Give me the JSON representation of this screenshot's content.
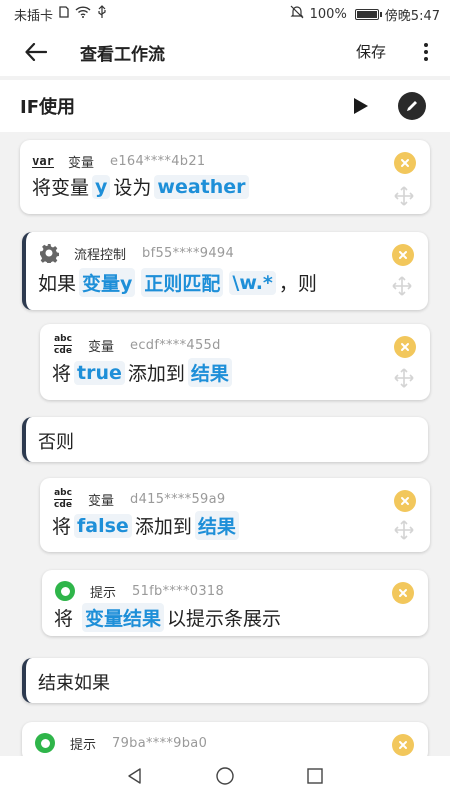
{
  "status_bar": {
    "carrier": "未插卡",
    "battery_text": "100%",
    "battery_level": 1.0,
    "time": "傍晚5:47"
  },
  "app_bar": {
    "title": "查看工作流",
    "save_label": "保存",
    "back_icon": "arrow-left-icon",
    "more_icon": "more-vert-icon"
  },
  "workflow": {
    "name": "IF使用",
    "run_icon": "play-icon",
    "edit_icon": "pencil-icon"
  },
  "cards": [
    {
      "icon_text": "var",
      "category": "变量",
      "id": "e164****4b21",
      "parts": [
        "将变量",
        "y",
        "设为",
        "weather"
      ]
    },
    {
      "category": "流程控制",
      "id": "bf55****9494",
      "parts": [
        "如果",
        "变量y",
        "正则匹配",
        "\\w.*",
        "，则"
      ]
    },
    {
      "icon_text_top": "abc",
      "icon_text_bottom": "cde",
      "category": "变量",
      "id": "ecdf****455d",
      "parts": [
        "将",
        "true",
        "添加到",
        "结果"
      ]
    },
    {
      "label": "否则"
    },
    {
      "icon_text_top": "abc",
      "icon_text_bottom": "cde",
      "category": "变量",
      "id": "d415****59a9",
      "parts": [
        "将",
        "false",
        "添加到",
        "结果"
      ]
    },
    {
      "category": "提示",
      "id": "51fb****0318",
      "parts": [
        "将",
        "变量结果",
        "以提示条展示"
      ]
    },
    {
      "label": "结束如果"
    },
    {
      "category": "提示",
      "id": "79ba****9ba0"
    }
  ],
  "colors": {
    "accent_chip_text": "#1e8fd8",
    "chip_bg": "#eef3f8",
    "close_badge": "#f2c75c",
    "block_accent": "#2d3a4f",
    "bulb_green": "#2fb54a"
  }
}
